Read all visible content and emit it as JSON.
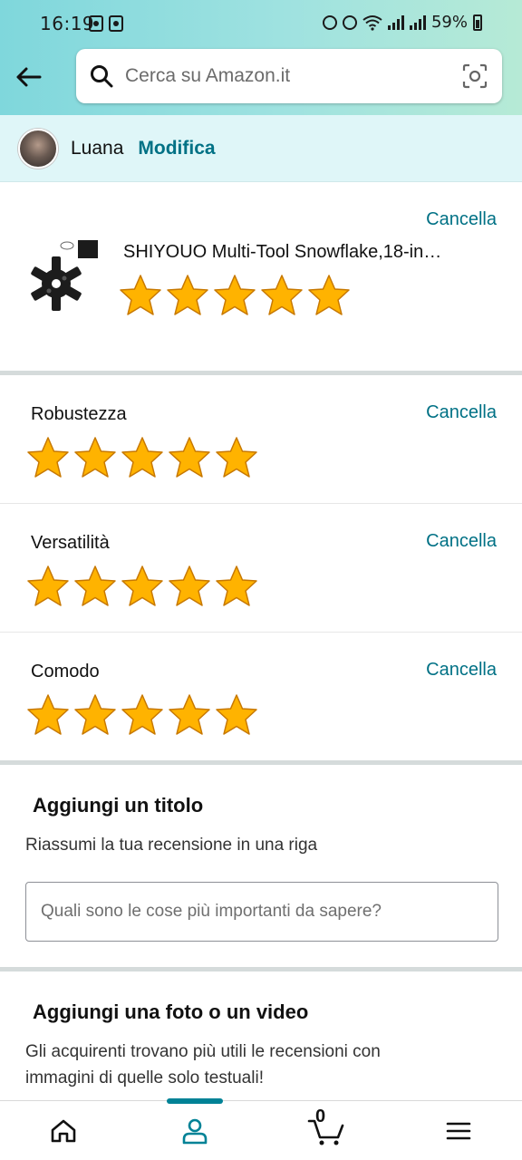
{
  "status_bar": {
    "time": "16:19",
    "battery": "59%"
  },
  "search": {
    "placeholder": "Cerca su Amazon.it"
  },
  "profile": {
    "name": "Luana",
    "edit_label": "Modifica"
  },
  "product": {
    "title": "SHIYOUO Multi-Tool Snowflake,18-in…",
    "rating": 5,
    "max_rating": 5,
    "cancel_label": "Cancella"
  },
  "attributes": [
    {
      "label": "Robustezza",
      "rating": 5,
      "cancel_label": "Cancella"
    },
    {
      "label": "Versatilità",
      "rating": 5,
      "cancel_label": "Cancella"
    },
    {
      "label": "Comodo",
      "rating": 5,
      "cancel_label": "Cancella"
    }
  ],
  "title_section": {
    "heading": "Aggiungi un titolo",
    "subtitle": "Riassumi la tua recensione in una riga",
    "input_placeholder": "Quali sono le cose più importanti da sapere?"
  },
  "media_section": {
    "heading": "Aggiungi una foto o un video",
    "subtitle_line1": "Gli acquirenti trovano più utili le recensioni con",
    "subtitle_line2": "immagini di quelle solo testuali!"
  },
  "bottom_nav": {
    "items": [
      {
        "icon": "home-icon"
      },
      {
        "icon": "account-icon",
        "active": true
      },
      {
        "icon": "cart-icon"
      },
      {
        "icon": "menu-icon"
      }
    ],
    "cart_count": "0"
  },
  "colors": {
    "accent": "#007185",
    "star": "#FFA41C",
    "header_gradient_start": "#7fd7dc",
    "header_gradient_end": "#b6ead6",
    "profile_bar": "#dff6f8",
    "nav_active": "#008296"
  },
  "icons": {
    "back": "arrow-left-icon",
    "search": "search-icon",
    "camera": "camera-scan-icon",
    "star": "star-icon"
  }
}
